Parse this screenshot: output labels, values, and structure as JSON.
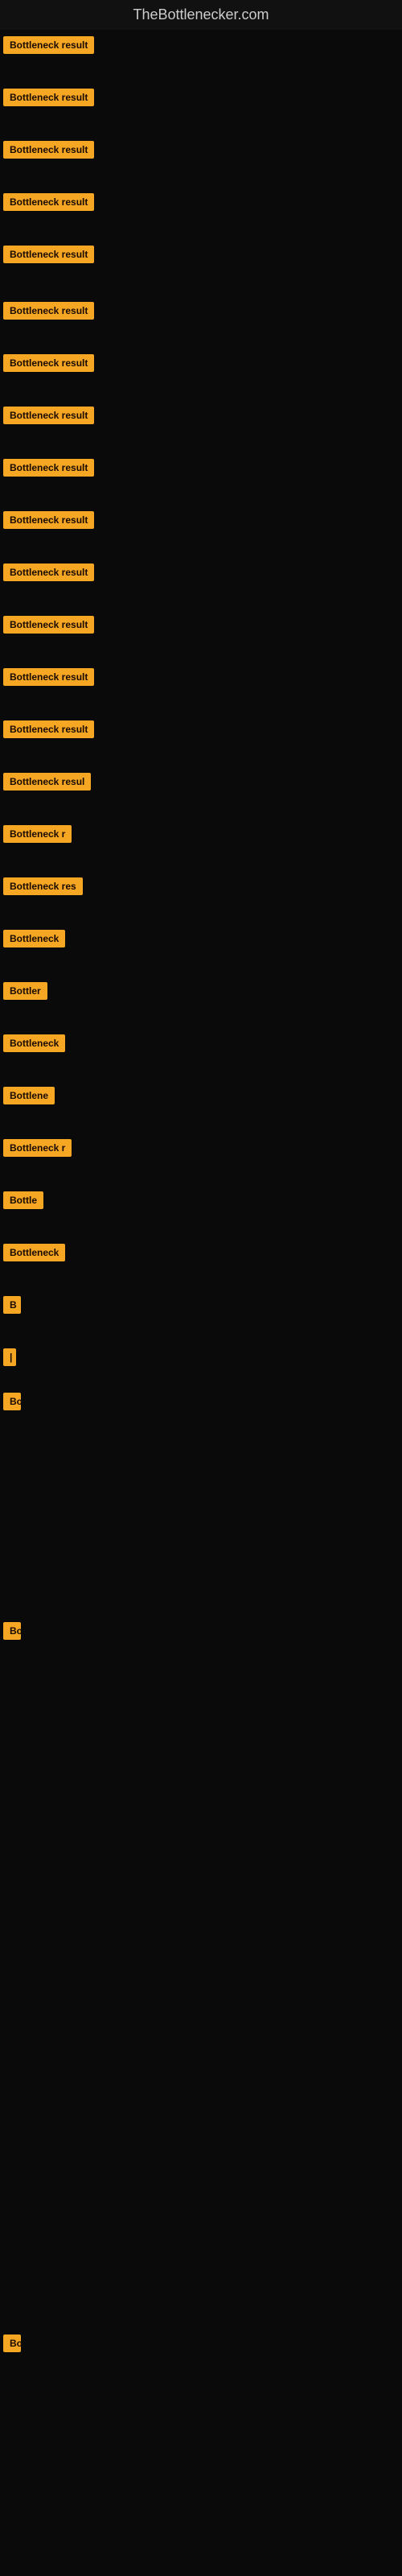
{
  "site": {
    "title": "TheBottlenecker.com"
  },
  "badge_label": "Bottleneck result",
  "items": [
    {
      "id": 1,
      "width_class": "w-full",
      "label": "Bottleneck result"
    },
    {
      "id": 2,
      "width_class": "w-full",
      "label": "Bottleneck result"
    },
    {
      "id": 3,
      "width_class": "w-full",
      "label": "Bottleneck result"
    },
    {
      "id": 4,
      "width_class": "w-full",
      "label": "Bottleneck result"
    },
    {
      "id": 5,
      "width_class": "w-full",
      "label": "Bottleneck result"
    },
    {
      "id": 6,
      "width_class": "w-full",
      "label": "Bottleneck result"
    },
    {
      "id": 7,
      "width_class": "w-full",
      "label": "Bottleneck result"
    },
    {
      "id": 8,
      "width_class": "w-full",
      "label": "Bottleneck result"
    },
    {
      "id": 9,
      "width_class": "w-full",
      "label": "Bottleneck result"
    },
    {
      "id": 10,
      "width_class": "w-full",
      "label": "Bottleneck result"
    },
    {
      "id": 11,
      "width_class": "w-full",
      "label": "Bottleneck result"
    },
    {
      "id": 12,
      "width_class": "w-full",
      "label": "Bottleneck result"
    },
    {
      "id": 13,
      "width_class": "w-full",
      "label": "Bottleneck result"
    },
    {
      "id": 14,
      "width_class": "w-full",
      "label": "Bottleneck result"
    },
    {
      "id": 15,
      "width_class": "w-large",
      "label": "Bottleneck resul"
    },
    {
      "id": 16,
      "width_class": "w-medium",
      "label": "Bottleneck r"
    },
    {
      "id": 17,
      "width_class": "w-medium",
      "label": "Bottleneck res"
    },
    {
      "id": 18,
      "width_class": "w-medium",
      "label": "Bottleneck"
    },
    {
      "id": 19,
      "width_class": "w-small",
      "label": "Bottler"
    },
    {
      "id": 20,
      "width_class": "w-medium",
      "label": "Bottleneck"
    },
    {
      "id": 21,
      "width_class": "w-small",
      "label": "Bottlene"
    },
    {
      "id": 22,
      "width_class": "w-medium",
      "label": "Bottleneck r"
    },
    {
      "id": 23,
      "width_class": "w-small",
      "label": "Bottle"
    },
    {
      "id": 24,
      "width_class": "w-medium",
      "label": "Bottleneck"
    },
    {
      "id": 25,
      "width_class": "w-tiny",
      "label": "B"
    },
    {
      "id": 26,
      "width_class": "w-nano",
      "label": "|"
    },
    {
      "id": 27,
      "width_class": "w-tiny",
      "label": "Bo"
    },
    {
      "id": 28,
      "width_class": "w-tiny",
      "label": "Bo"
    }
  ],
  "colors": {
    "badge_bg": "#f5a623",
    "badge_text": "#1a0a00",
    "background": "#0a0a0a",
    "site_title": "#cccccc"
  }
}
